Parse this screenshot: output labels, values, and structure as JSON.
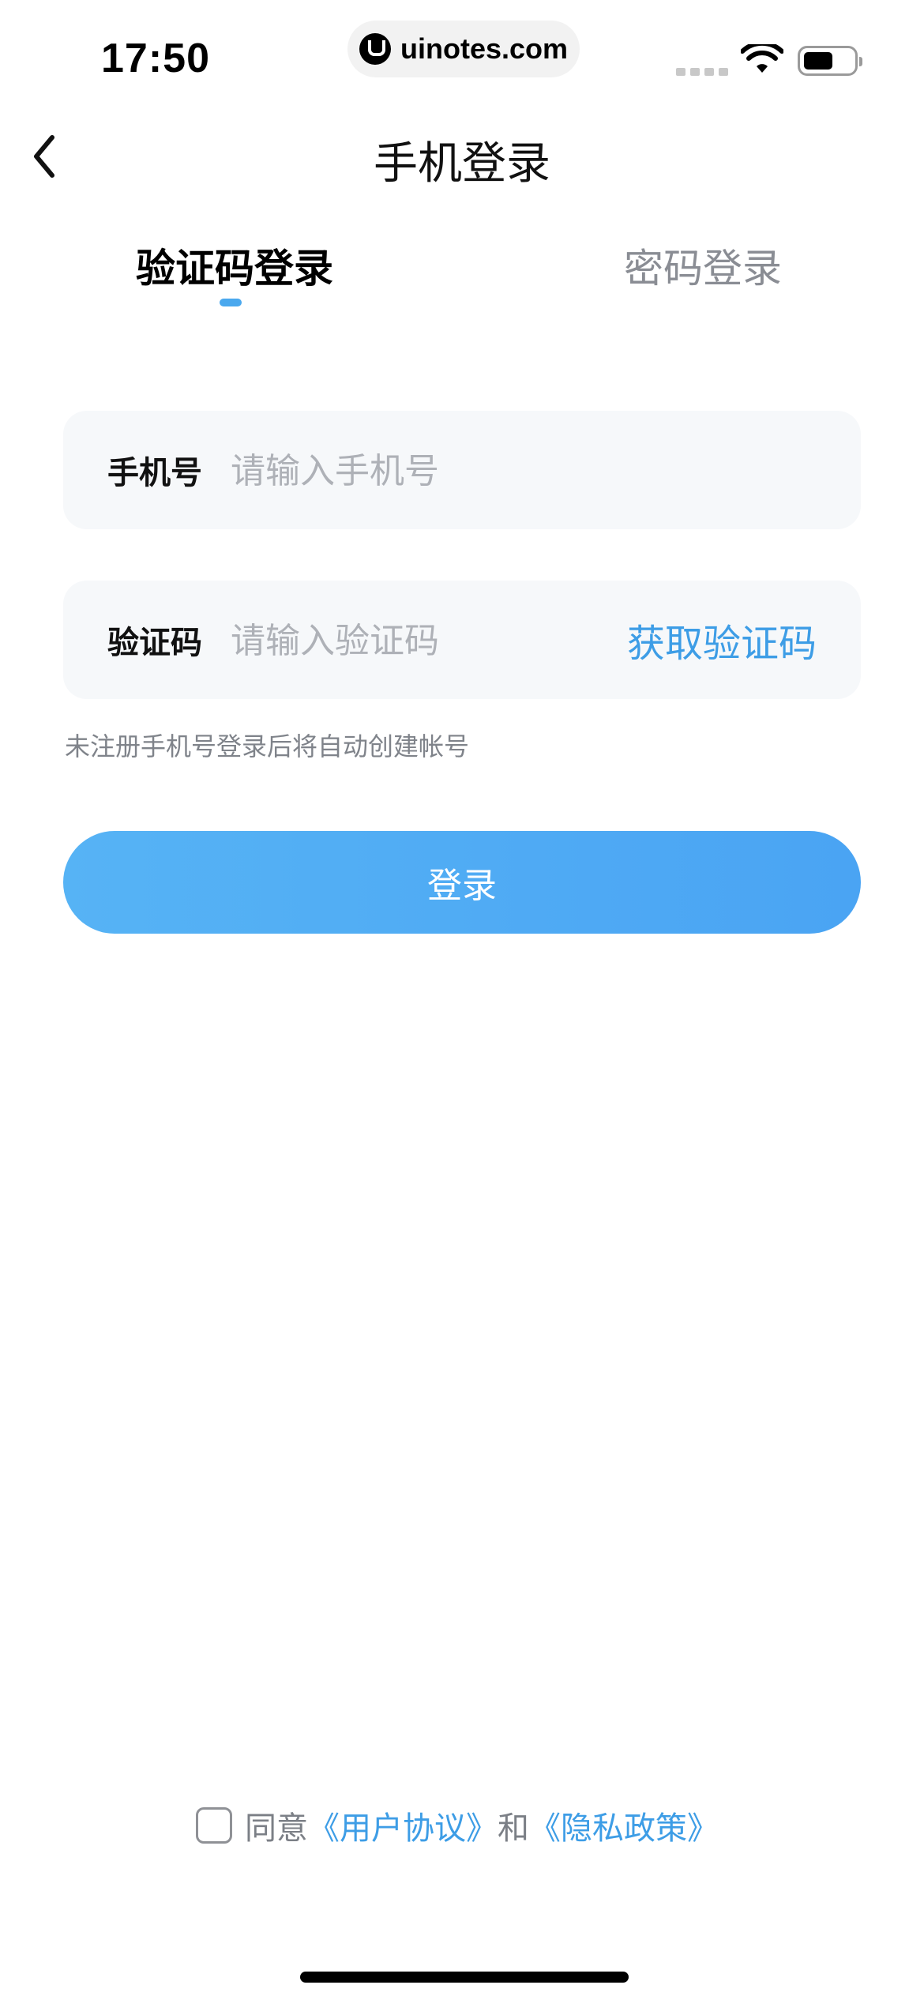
{
  "status_bar": {
    "time": "17:50",
    "url": "uinotes.com",
    "icons": [
      "signal-icon",
      "wifi-icon",
      "battery-icon"
    ]
  },
  "nav": {
    "title": "手机登录",
    "back_icon": "chevron-left-icon"
  },
  "tabs": [
    {
      "label": "验证码登录",
      "active": true
    },
    {
      "label": "密码登录",
      "active": false
    }
  ],
  "form": {
    "phone": {
      "label": "手机号",
      "placeholder": "请输入手机号",
      "value": ""
    },
    "code": {
      "label": "验证码",
      "placeholder": "请输入验证码",
      "value": "",
      "action": "获取验证码"
    },
    "hint": "未注册手机号登录后将自动创建帐号",
    "submit_label": "登录"
  },
  "agreement": {
    "checked": false,
    "prefix": "同意",
    "user_agreement": "《用户协议》",
    "and": "和",
    "privacy_policy": "《隐私政策》"
  },
  "colors": {
    "accent": "#3d9de6",
    "button_start": "#56b3f5",
    "button_end": "#4aa4f3",
    "field_bg": "#f6f8fa"
  }
}
